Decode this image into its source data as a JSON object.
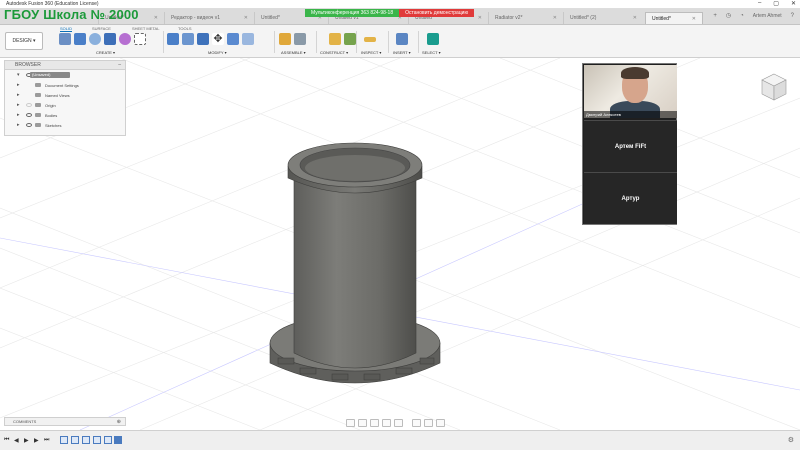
{
  "app": {
    "window_title": "Autodesk Fusion 360 (Education License)"
  },
  "watermark": "ГБОУ Школа № 2000",
  "meeting": {
    "id_label": "Мультиконференция 363 824-98-18",
    "stop_label": "Остановить демонстрацию"
  },
  "tabs": [
    {
      "label": "Untitled*"
    },
    {
      "label": "Редактор - видеоч v1"
    },
    {
      "label": "Untitled*"
    },
    {
      "label": "Untitled v1"
    },
    {
      "label": "Untitled*"
    },
    {
      "label": "Radiator v2*"
    },
    {
      "label": "Untitled* (2)"
    },
    {
      "label": "Untitled*"
    }
  ],
  "user": "Artem Ahmet",
  "toolbar": {
    "design_label": "DESIGN ▾",
    "workspace_tabs": [
      "SOLID",
      "SURFACE",
      "SHEET METAL",
      "TOOLS"
    ],
    "groups": [
      "CREATE ▾",
      "MODIFY ▾",
      "ASSEMBLE ▾",
      "CONSTRUCT ▾",
      "INSPECT ▾",
      "INSERT ▾",
      "SELECT ▾"
    ]
  },
  "browser": {
    "title": "BROWSER",
    "root": "(Unsaved)",
    "items": [
      "Document Settings",
      "Named Views",
      "Origin",
      "Bodies",
      "Sketches"
    ]
  },
  "participants": {
    "video_name": "Дмитрий Алексеев",
    "p1": "Артем FiFt",
    "p2": "Артур"
  },
  "comments_label": "COMMENTS",
  "colors": {
    "watermark": "#1c9a3a",
    "accent": "#0a6fb8",
    "meeting_green": "#3ab54a",
    "meeting_red": "#e03a3a",
    "model": "#6e6e6a"
  }
}
